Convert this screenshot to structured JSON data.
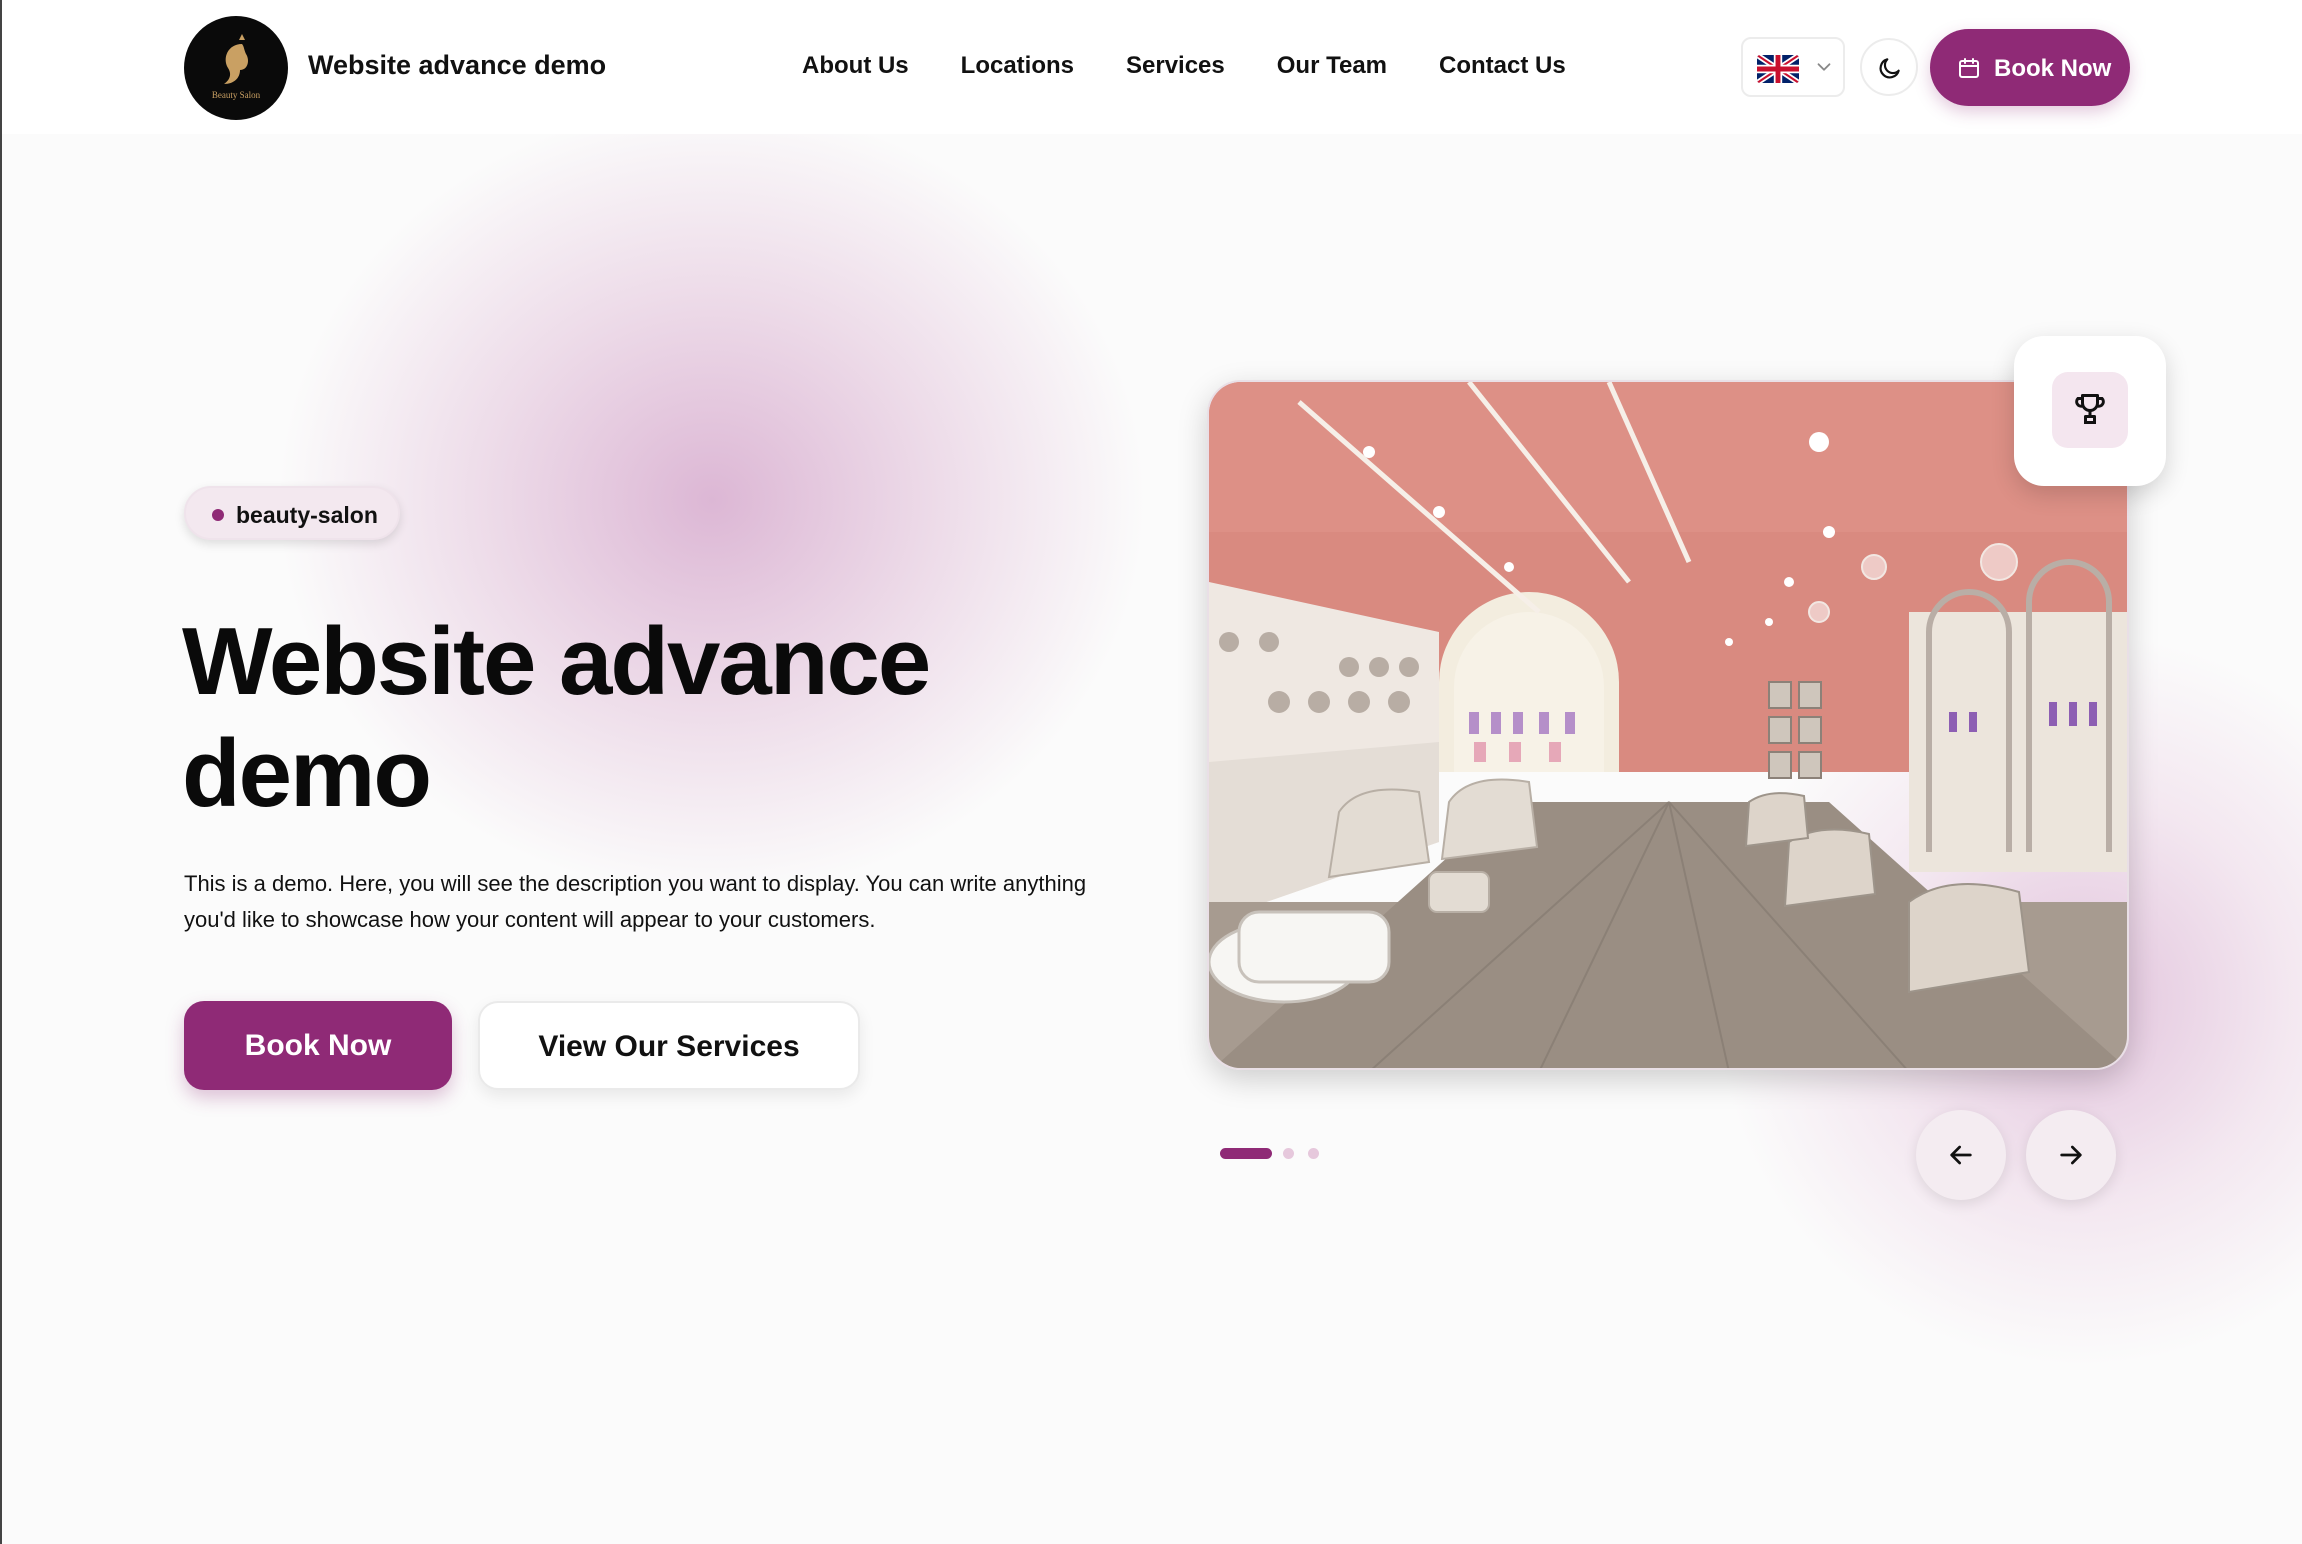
{
  "header": {
    "brand": "Website advance demo",
    "logo_text": "Beauty Salon",
    "nav": [
      "About Us",
      "Locations",
      "Services",
      "Our Team",
      "Contact Us"
    ],
    "language_icon": "uk-flag-icon",
    "theme_icon": "moon-icon",
    "book_label": "Book Now"
  },
  "hero": {
    "tag": "beauty-salon",
    "title": "Website advance demo",
    "description": "This is a demo. Here, you will see the description you want to display. You can write anything you'd like to showcase how your content will appear to your customers.",
    "primary_cta": "Book Now",
    "secondary_cta": "View Our Services"
  },
  "carousel": {
    "slide_count": 3,
    "active_slide": 1
  },
  "colors": {
    "accent": "#8f2a76",
    "background": "#fbfbfb",
    "salon_walls": "#d9857a"
  }
}
